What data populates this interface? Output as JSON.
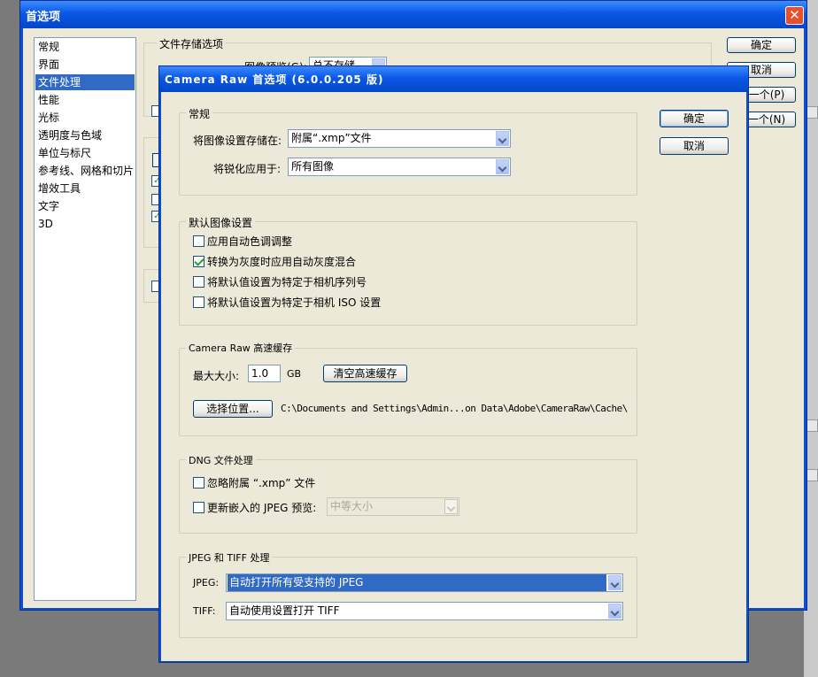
{
  "outer_window": {
    "title": "首选项",
    "close_glyph": "✕",
    "nav_items": [
      {
        "label": "常规",
        "selected": false
      },
      {
        "label": "界面",
        "selected": false
      },
      {
        "label": "文件处理",
        "selected": true
      },
      {
        "label": "性能",
        "selected": false
      },
      {
        "label": "光标",
        "selected": false
      },
      {
        "label": "透明度与色域",
        "selected": false
      },
      {
        "label": "单位与标尺",
        "selected": false
      },
      {
        "label": "参考线、网格和切片",
        "selected": false
      },
      {
        "label": "增效工具",
        "selected": false
      },
      {
        "label": "文字",
        "selected": false
      },
      {
        "label": "3D",
        "selected": false
      }
    ],
    "file_save_group_label": "文件存储选项",
    "image_preview_label": "图像预览(G):",
    "image_preview_value": "总不存储",
    "buttons": {
      "ok": "确定",
      "cancel": "取消",
      "prev": "上一个(P)",
      "next": "下一个(N)"
    }
  },
  "camera_raw": {
    "title": "Camera Raw 首选项  (6.0.0.205 版)",
    "buttons": {
      "ok": "确定",
      "cancel": "取消"
    },
    "general": {
      "label": "常规",
      "save_settings_label": "将图像设置存储在:",
      "save_settings_value": "附属“.xmp”文件",
      "sharpen_label": "将锐化应用于:",
      "sharpen_value": "所有图像"
    },
    "default_image": {
      "label": "默认图像设置",
      "options": [
        {
          "label": "应用自动色调调整",
          "checked": false
        },
        {
          "label": "转换为灰度时应用自动灰度混合",
          "checked": true
        },
        {
          "label": "将默认值设置为特定于相机序列号",
          "checked": false
        },
        {
          "label": "将默认值设置为特定于相机 ISO 设置",
          "checked": false
        }
      ]
    },
    "cache": {
      "label": "Camera Raw 高速缓存",
      "max_size_label": "最大大小:",
      "max_size_value": "1.0",
      "unit": "GB",
      "purge_button": "清空高速缓存",
      "select_location_button": "选择位置...",
      "path": "C:\\Documents and Settings\\Admin...on Data\\Adobe\\CameraRaw\\Cache\\"
    },
    "dng": {
      "label": "DNG 文件处理",
      "ignore_sidecar_label": "忽略附属 “.xmp” 文件",
      "ignore_sidecar_checked": false,
      "update_jpeg_label": "更新嵌入的 JPEG 预览:",
      "update_jpeg_checked": false,
      "preview_size_value": "中等大小"
    },
    "jpeg_tiff": {
      "label": "JPEG 和 TIFF 处理",
      "jpeg_label": "JPEG:",
      "jpeg_value": "自动打开所有受支持的 JPEG",
      "tiff_label": "TIFF:",
      "tiff_value": "自动使用设置打开 TIFF"
    }
  }
}
